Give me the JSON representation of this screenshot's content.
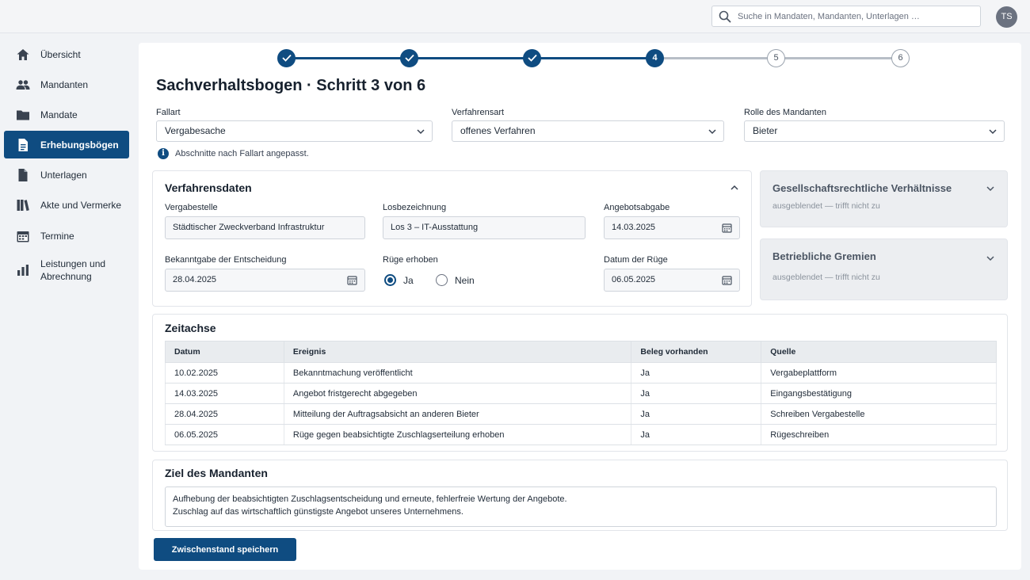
{
  "search": {
    "placeholder": "Suche in Mandaten, Mandanten, Unterlagen …",
    "icon": "search-icon"
  },
  "user": {
    "initials": "TS"
  },
  "sidebar": {
    "items": [
      {
        "label": "Übersicht",
        "icon": "home-icon"
      },
      {
        "label": "Mandanten",
        "icon": "people-icon"
      },
      {
        "label": "Mandate",
        "icon": "folder-icon"
      },
      {
        "label": "Erhebungsbögen",
        "icon": "document-icon",
        "active": true
      },
      {
        "label": "Unterlagen",
        "icon": "file-icon"
      },
      {
        "label": "Akte und Vermerke",
        "icon": "books-icon"
      },
      {
        "label": "Termine",
        "icon": "calendar-icon"
      },
      {
        "label": "Leistungen und Abrechnung",
        "icon": "bar-chart-icon"
      }
    ]
  },
  "stepper": {
    "steps": [
      {
        "label": "",
        "state": "done"
      },
      {
        "label": "",
        "state": "done"
      },
      {
        "label": "",
        "state": "done"
      },
      {
        "label": "4",
        "state": "current"
      },
      {
        "label": "5",
        "state": "todo"
      },
      {
        "label": "6",
        "state": "todo"
      }
    ]
  },
  "page": {
    "title": "Sachverhaltsbogen · Schritt 3 von 6"
  },
  "filters": {
    "fallart": {
      "label": "Fallart",
      "value": "Vergabesache"
    },
    "verfahrensart": {
      "label": "Verfahrensart",
      "value": "offenes Verfahren"
    },
    "rolle": {
      "label": "Rolle des Mandanten",
      "value": "Bieter"
    }
  },
  "info_text": "Abschnitte nach Fallart angepasst.",
  "verfahrensdaten": {
    "title": "Verfahrensdaten",
    "vergabestelle": {
      "label": "Vergabestelle",
      "value": "Städtischer Zweckverband Infrastruktur"
    },
    "losbezeichnung": {
      "label": "Losbezeichnung",
      "value": "Los 3 – IT-Ausstattung"
    },
    "angebotsabgabe": {
      "label": "Angebotsabgabe",
      "value": "14.03.2025"
    },
    "bekanntgabe": {
      "label": "Bekanntgabe der Entscheidung",
      "value": "28.04.2025"
    },
    "ruege": {
      "label": "Rüge erhoben",
      "yes": "Ja",
      "no": "Nein",
      "selected": "Ja"
    },
    "datum_ruege": {
      "label": "Datum der Rüge",
      "value": "06.05.2025"
    }
  },
  "side_cards": [
    {
      "title": "Gesellschaftsrechtliche Verhältnisse",
      "status": "ausgeblendet — trifft nicht zu"
    },
    {
      "title": "Betriebliche Gremien",
      "status": "ausgeblendet — trifft nicht zu"
    }
  ],
  "zeitachse": {
    "title": "Zeitachse",
    "columns": [
      "Datum",
      "Ereignis",
      "Beleg vorhanden",
      "Quelle"
    ],
    "rows": [
      [
        "10.02.2025",
        "Bekanntmachung veröffentlicht",
        "Ja",
        "Vergabeplattform"
      ],
      [
        "14.03.2025",
        "Angebot fristgerecht abgegeben",
        "Ja",
        "Eingangsbestätigung"
      ],
      [
        "28.04.2025",
        "Mitteilung der Auftragsabsicht an anderen Bieter",
        "Ja",
        "Schreiben Vergabestelle"
      ],
      [
        "06.05.2025",
        "Rüge gegen beabsichtigte Zuschlagserteilung erhoben",
        "Ja",
        "Rügeschreiben"
      ]
    ]
  },
  "ziel": {
    "title": "Ziel des Mandanten",
    "text": "Aufhebung der beabsichtigten Zuschlagsentscheidung und erneute, fehlerfreie Wertung der Angebote.\nZuschlag auf das wirtschaftlich günstigste Angebot unseres Unternehmens."
  },
  "actions": {
    "save_label": "Zwischenstand speichern"
  },
  "colors": {
    "primary": "#0f4c81",
    "background": "#f1f3f6",
    "muted_card": "#eceef1"
  }
}
